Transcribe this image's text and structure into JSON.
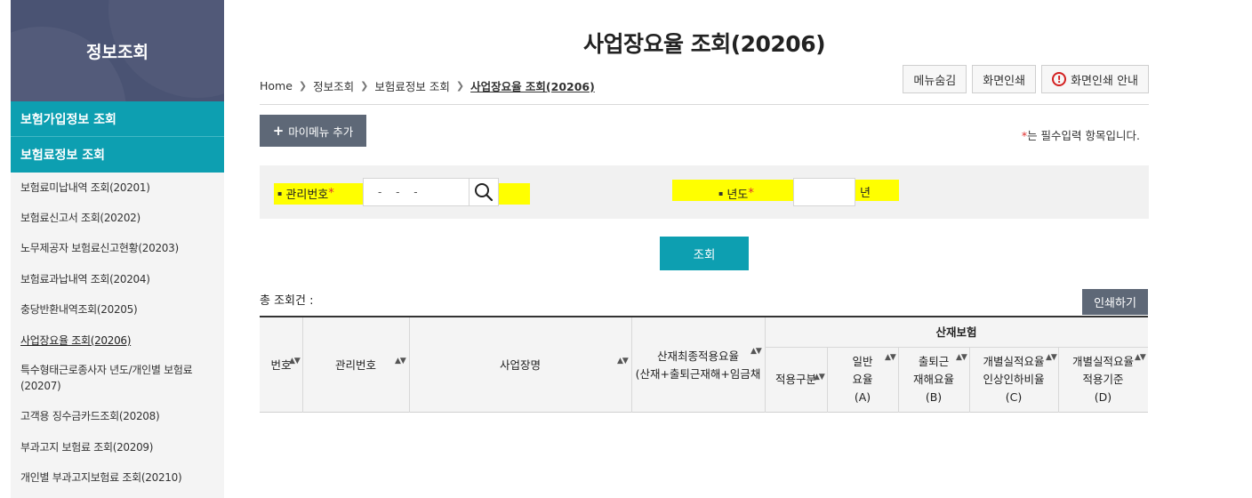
{
  "sidebar": {
    "title": "정보조회",
    "categories": [
      "보험가입정보 조회",
      "보험료정보 조회"
    ],
    "items": [
      "보험료미납내역 조회(20201)",
      "보험료신고서 조회(20202)",
      "노무제공자 보험료신고현황(20203)",
      "보험료과납내역 조회(20204)",
      "충당반환내역조회(20205)",
      "사업장요율 조회(20206)",
      "특수형태근로종사자 년도/개인별 보험료(20207)",
      "고객용 징수금카드조회(20208)",
      "부과고지 보험료 조회(20209)",
      "개인별 부과고지보험료 조회(20210)"
    ],
    "active_index": 5
  },
  "page": {
    "title": "사업장요율 조회(20206)",
    "breadcrumb": [
      "Home",
      "정보조회",
      "보험료정보 조회",
      "사업장요율 조회(20206)"
    ]
  },
  "toolbar": {
    "hide_menu": "메뉴숨김",
    "print_screen": "화면인쇄",
    "print_guide": "화면인쇄 안내",
    "alert_glyph": "!"
  },
  "mymenu": {
    "plus": "+",
    "label": "마이메뉴 추가"
  },
  "required_note": {
    "star": "*",
    "text": "는 필수입력 항목입니다."
  },
  "search": {
    "mgmt_label": "관리번호",
    "mgmt_value": "- - -",
    "year_label": "년도",
    "year_value": "",
    "year_unit": "년",
    "required_star": "*",
    "bullet": "▪"
  },
  "query_button": "조회",
  "results": {
    "total_label": "총 조회건 :",
    "print_button": "인쇄하기"
  },
  "table": {
    "headers": {
      "no": "번호",
      "mgmt_no": "관리번호",
      "site_name": "사업장명",
      "final_rate_line1": "산재최종적용요율",
      "final_rate_line2": "(산재+출퇴근재해+임금채",
      "group": "산재보험",
      "apply_type": "적용구분",
      "general_rate": [
        "일반",
        "요율",
        "(A)"
      ],
      "commute_rate": [
        "출퇴근",
        "재해요율",
        "(B)"
      ],
      "merit_rate": [
        "개별실적요율",
        "인상인하비율",
        "(C)"
      ],
      "merit_basis": [
        "개별실적요율",
        "적용기준",
        "(D)"
      ]
    },
    "sort_glyph": "▲▼",
    "rows": []
  },
  "colors": {
    "sidebar_header": "#4a5373",
    "accent_teal": "#0d9fb1",
    "dark_button": "#5e6877",
    "highlight": "#ffff00",
    "required": "#e0302f"
  }
}
